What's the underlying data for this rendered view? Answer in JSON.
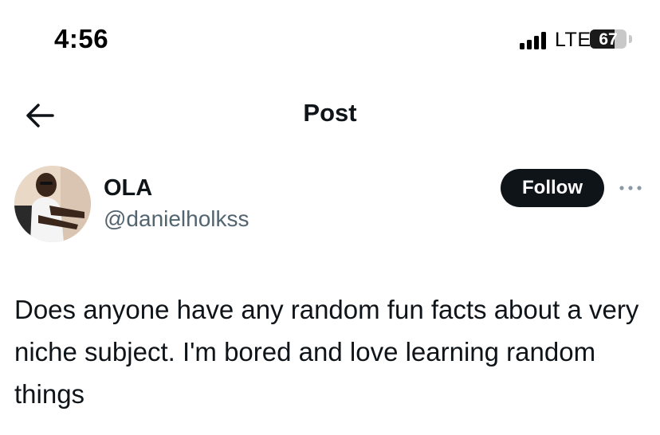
{
  "status_bar": {
    "time": "4:56",
    "network": "LTE",
    "battery_level": "67",
    "battery_fraction": 0.67
  },
  "nav": {
    "back_icon": "arrow-left-icon",
    "title": "Post"
  },
  "post": {
    "author": {
      "name": "OLA",
      "handle": "@danielholkss"
    },
    "follow_label": "Follow",
    "more_icon": "more-horizontal-icon",
    "text": "Does anyone have any random fun facts about a very niche subject. I'm bored and love learning random things"
  },
  "colors": {
    "text_primary": "#0f1419",
    "text_secondary": "#536471",
    "follow_button_bg": "#0f1419",
    "background": "#ffffff"
  }
}
